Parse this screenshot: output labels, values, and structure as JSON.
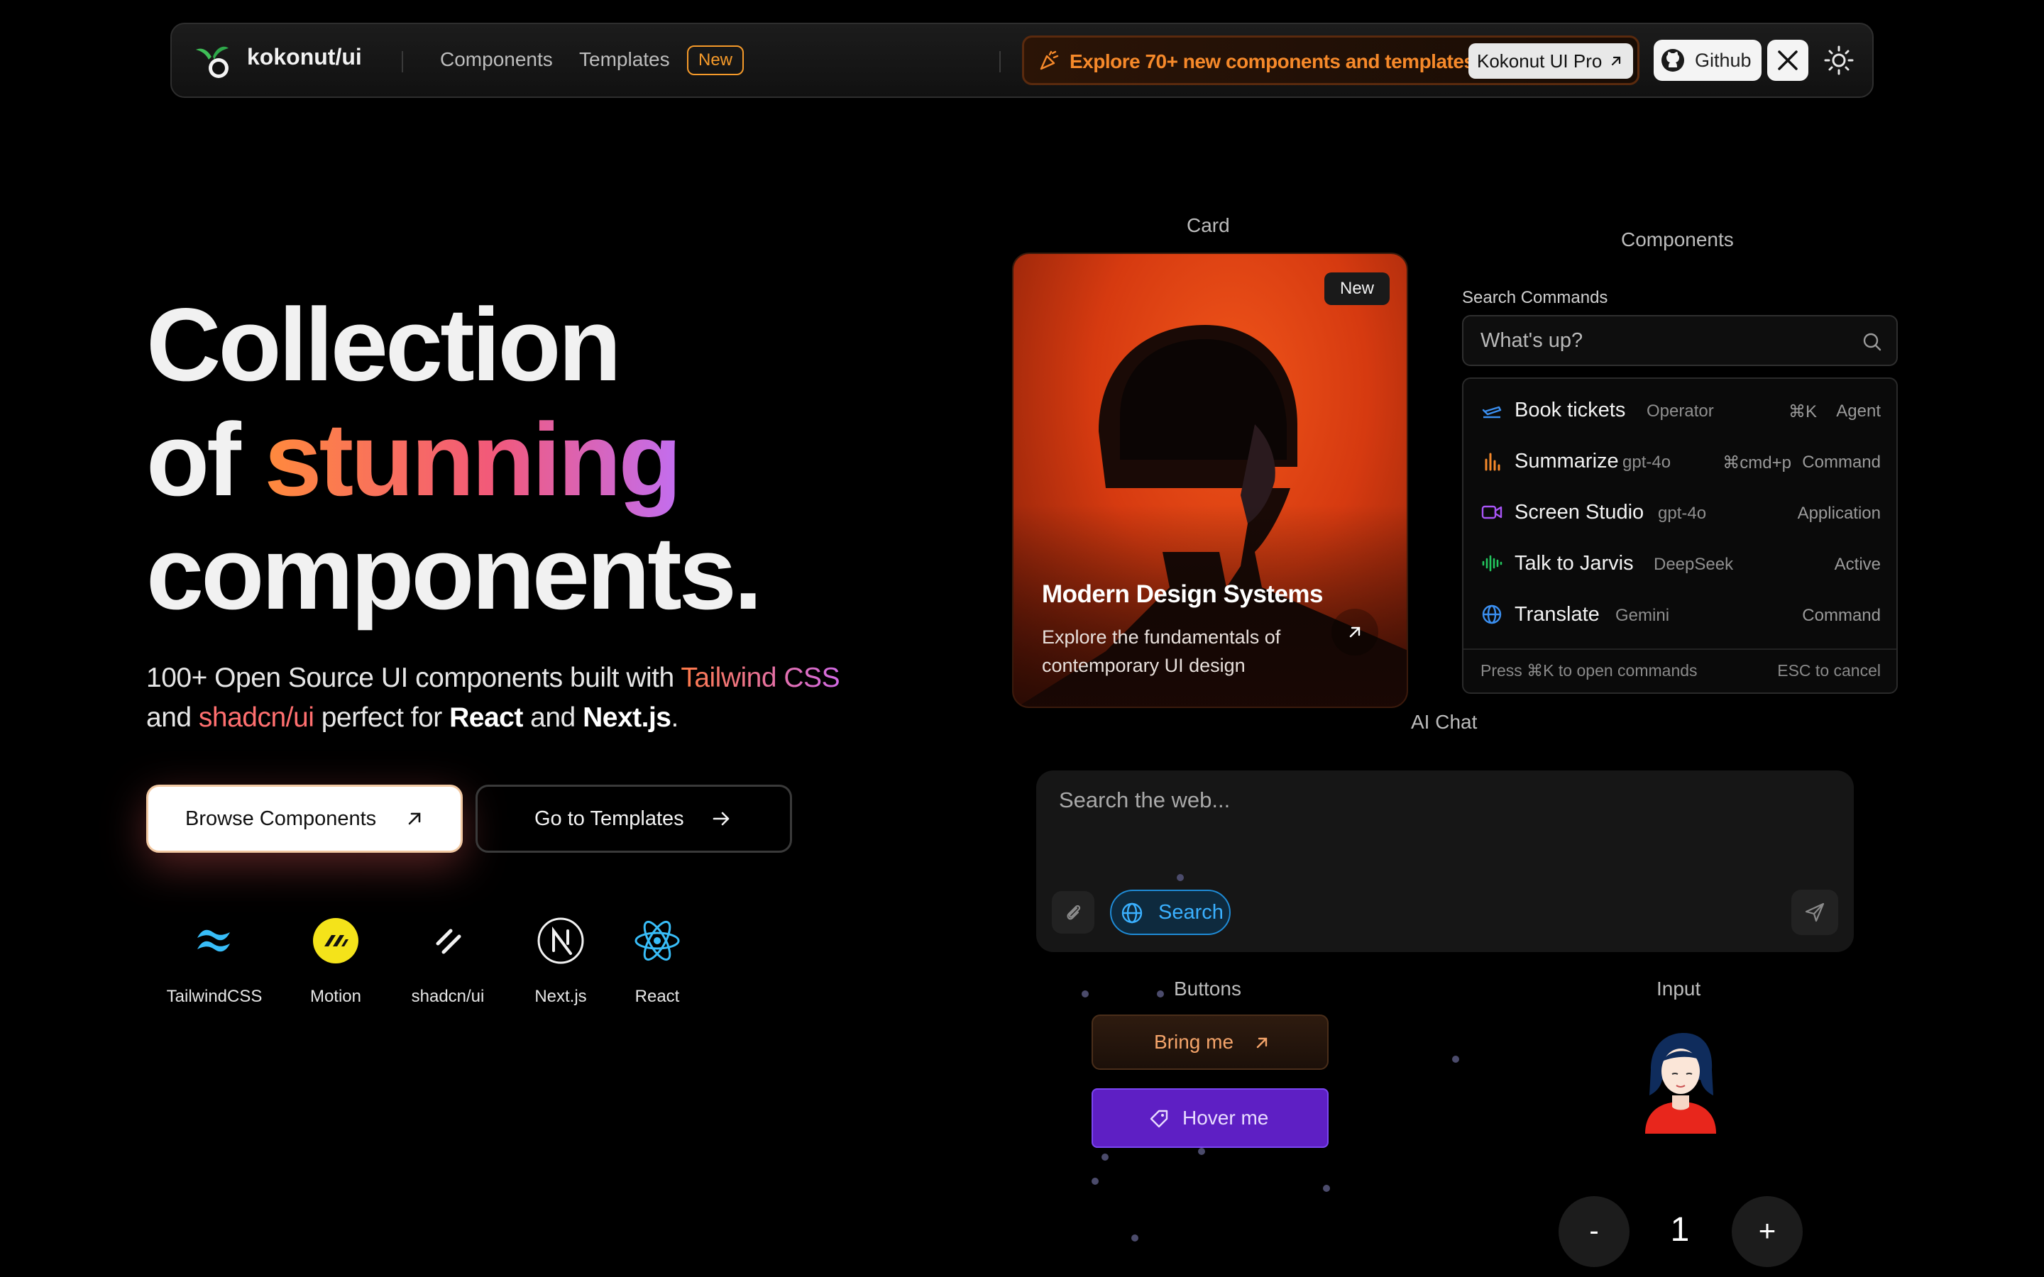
{
  "nav": {
    "brand": "kokonut/ui",
    "links": [
      "Components",
      "Templates"
    ],
    "new_badge": "New",
    "promo_text": "Explore 70+ new components and templates",
    "pro_label": "Kokonut UI Pro",
    "github_label": "Github"
  },
  "hero": {
    "line1": "Collection",
    "line2_a": "of ",
    "line2_b": "stunning",
    "line3": "components.",
    "sub1_a": "100+ Open Source UI components built with ",
    "sub1_b": "Tailwind CSS",
    "sub2_a": "and ",
    "sub2_b": "shadcn/ui",
    "sub2_c": " perfect for ",
    "sub2_d": "React",
    "sub2_e": " and ",
    "sub2_f": "Next.js",
    "sub2_g": ".",
    "browse_label": "Browse Components",
    "templates_label": "Go to Templates",
    "tech": [
      "TailwindCSS",
      "Motion",
      "shadcn/ui",
      "Next.js",
      "React"
    ]
  },
  "sections": {
    "card": "Card",
    "components": "Components",
    "ai_chat": "AI Chat",
    "buttons": "Buttons",
    "input": "Input"
  },
  "card": {
    "badge": "New",
    "title": "Modern Design Systems",
    "desc": "Explore the fundamentals of contemporary UI design"
  },
  "commands": {
    "title": "Search Commands",
    "placeholder": "What's up?",
    "items": [
      {
        "label": "Book tickets",
        "sub": "Operator",
        "shortcut": "⌘K",
        "right": "Agent",
        "icon": "plane-icon"
      },
      {
        "label": "Summarize",
        "sub": "gpt-4o",
        "shortcut": "⌘cmd+p",
        "right": "Command",
        "icon": "bar-chart-icon"
      },
      {
        "label": "Screen Studio",
        "sub": "gpt-4o",
        "shortcut": "",
        "right": "Application",
        "icon": "video-icon"
      },
      {
        "label": "Talk to Jarvis",
        "sub": "DeepSeek",
        "shortcut": "",
        "right": "Active",
        "icon": "audio-wave-icon"
      },
      {
        "label": "Translate",
        "sub": "Gemini",
        "shortcut": "",
        "right": "Command",
        "icon": "globe-icon"
      }
    ],
    "footer_left": "Press ⌘K to open commands",
    "footer_right": "ESC to cancel"
  },
  "chat": {
    "placeholder": "Search the web...",
    "search_toggle": "Search"
  },
  "buttons_demo": {
    "bring_me": "Bring me",
    "hover_me": "Hover me"
  },
  "input_demo": {
    "minus": "-",
    "value": "1",
    "plus": "+"
  },
  "colors": {
    "accent_orange": "#f6892a",
    "hover_purple": "#5e1fc4",
    "search_blue": "#3ab0ff"
  }
}
